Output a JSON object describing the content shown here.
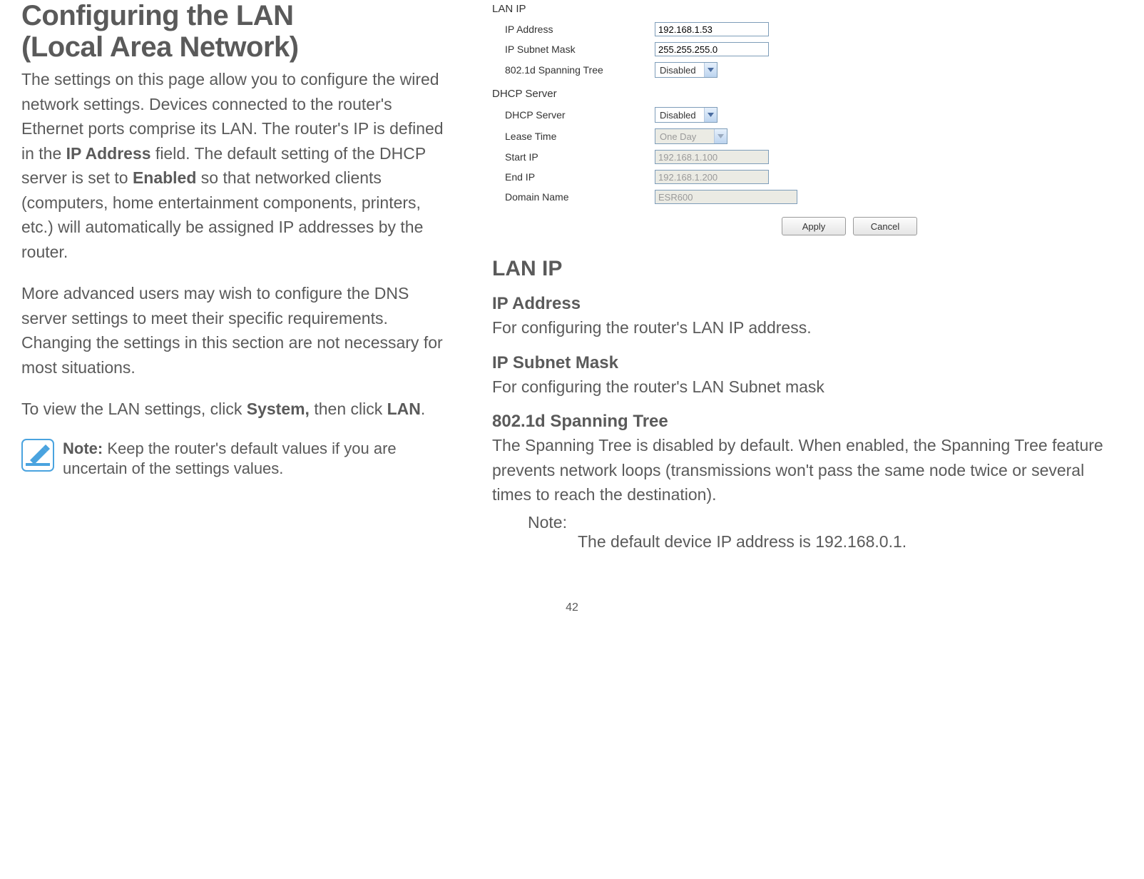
{
  "left": {
    "h1_line1": "Configuring the LAN",
    "h1_line2": "(Local Area Network)",
    "para1_a": "The settings on this page allow you to configure the wired network settings. Devices connected to the router's Ethernet ports comprise its LAN. The router's IP is defined in the ",
    "para1_b_strong": "IP Address",
    "para1_c": " field. The default setting of the DHCP server is set to ",
    "para1_d_strong": "Enabled",
    "para1_e": " so that networked clients (computers, home entertainment components, printers, etc.) will automatically be assigned IP addresses by the router.",
    "para2": "More advanced users may wish to configure the DNS server settings to meet their specific requirements. Changing the settings in this section are not necessary for most situations.",
    "para3_a": "To view the LAN settings, click ",
    "para3_b_strong": "System,",
    "para3_c": " then click ",
    "para3_d_strong": "LAN",
    "para3_e": ".",
    "note_strong": "Note:",
    "note_text": " Keep the router's default values if you are uncertain of the settings values."
  },
  "panel": {
    "section_lan": "LAN IP",
    "ip_address_label": "IP Address",
    "ip_address_value": "192.168.1.53",
    "subnet_label": "IP Subnet Mask",
    "subnet_value": "255.255.255.0",
    "spanning_label": "802.1d Spanning Tree",
    "spanning_value": "Disabled",
    "section_dhcp": "DHCP Server",
    "dhcp_server_label": "DHCP Server",
    "dhcp_server_value": "Disabled",
    "lease_label": "Lease Time",
    "lease_value": "One Day",
    "start_ip_label": "Start IP",
    "start_ip_value": "192.168.1.100",
    "end_ip_label": "End IP",
    "end_ip_value": "192.168.1.200",
    "domain_label": "Domain Name",
    "domain_value": "ESR600",
    "apply": "Apply",
    "cancel": "Cancel"
  },
  "right": {
    "h2": "LAN IP",
    "ipaddr_h": "IP Address",
    "ipaddr_d": "For configuring the router's LAN IP address.",
    "subnet_h": "IP Subnet Mask",
    "subnet_d": "For configuring the router's LAN Subnet mask",
    "span_h": "802.1d Spanning Tree",
    "span_d": "The Spanning Tree is disabled by default. When enabled, the Spanning Tree feature prevents network loops (transmissions won't pass the same node twice or several times to reach the destination).",
    "note_label": "Note:",
    "note_text": "The default device IP address is 192.168.0.1."
  },
  "page_number": "42"
}
